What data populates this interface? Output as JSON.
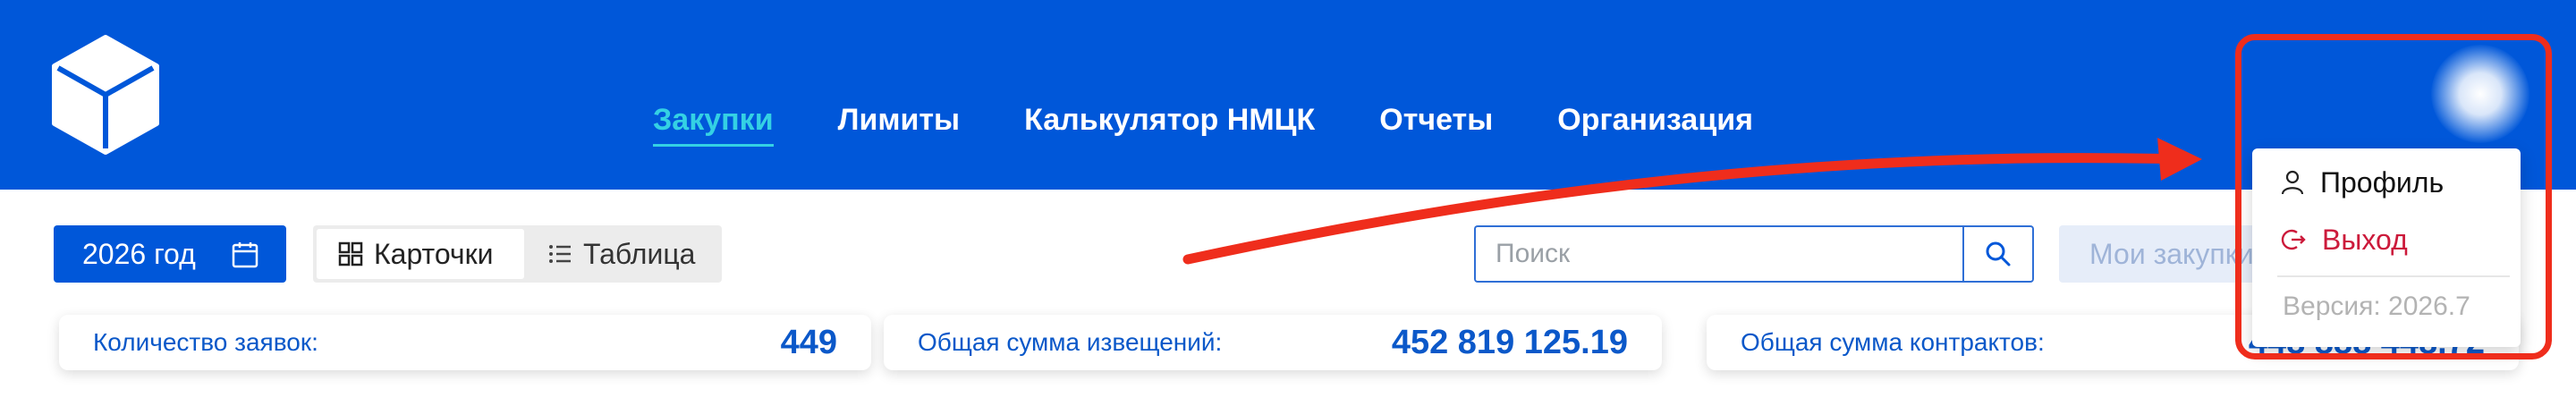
{
  "header": {
    "logo_icon": "cube-logo-icon",
    "nav": [
      {
        "label": "Закупки",
        "active": true
      },
      {
        "label": "Лимиты",
        "active": false
      },
      {
        "label": "Калькулятор НМЦК",
        "active": false
      },
      {
        "label": "Отчеты",
        "active": false
      },
      {
        "label": "Организация",
        "active": false
      }
    ],
    "accent_color": "#0057d9",
    "active_nav_color": "#34d1e4"
  },
  "toolbar": {
    "year_label": "2026 год",
    "year_icon": "calendar-icon",
    "view_cards_label": "Карточки",
    "view_cards_icon": "grid-icon",
    "view_table_label": "Таблица",
    "view_table_icon": "list-icon",
    "search_placeholder": "Поиск",
    "search_icon": "search-icon",
    "my_purchases_label": "Мои закупки"
  },
  "stats": [
    {
      "label": "Количество заявок:",
      "value": "449"
    },
    {
      "label": "Общая сумма извещений:",
      "value": "452 819 125.19"
    },
    {
      "label": "Общая сумма контрактов:",
      "value": "448 888 448.72"
    }
  ],
  "user_menu": {
    "profile_label": "Профиль",
    "profile_icon": "user-icon",
    "logout_label": "Выход",
    "logout_icon": "logout-icon",
    "version_text": "Версия: 2026.7",
    "logout_color": "#cc1a3b"
  },
  "annotation": {
    "color": "#ef2d1c"
  }
}
